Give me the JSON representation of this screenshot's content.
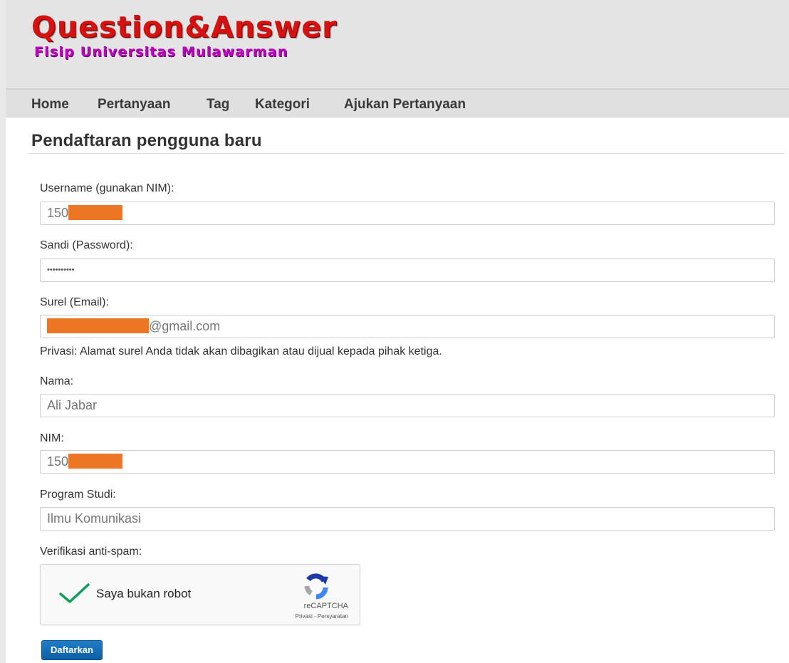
{
  "header": {
    "logo_main": "Question&Answer",
    "logo_sub": "Fisip Universitas Mulawarman"
  },
  "nav": {
    "items": [
      {
        "label": "Home"
      },
      {
        "label": "Pertanyaan"
      },
      {
        "label": "Tag"
      },
      {
        "label": "Kategori"
      },
      {
        "label": "Ajukan Pertanyaan"
      }
    ]
  },
  "page": {
    "title": "Pendaftaran pengguna baru"
  },
  "form": {
    "username": {
      "label": "Username (gunakan NIM):",
      "value": "150"
    },
    "password": {
      "label": "Sandi (Password):",
      "value": "••••••••••"
    },
    "email": {
      "label": "Surel (Email):",
      "value_suffix": "@gmail.com",
      "privacy_note": "Privasi: Alamat surel Anda tidak akan dibagikan atau dijual kepada pihak ketiga."
    },
    "nama": {
      "label": "Nama:",
      "value": "Ali Jabar"
    },
    "nim": {
      "label": "NIM:",
      "value": "150"
    },
    "program": {
      "label": "Program Studi:",
      "value": "Ilmu Komunikasi"
    },
    "verification_label": "Verifikasi anti-spam:",
    "captcha": {
      "text": "Saya bukan robot",
      "brand": "reCAPTCHA",
      "links": "Privasi - Persyaratan",
      "checked": true
    },
    "submit_label": "Daftarkan"
  },
  "colors": {
    "redaction": "#ec7624",
    "logo_main": "#d8100f",
    "logo_sub": "#c000c0",
    "button": "#1066b0",
    "check": "#0f9d58"
  },
  "icons": [
    "checkmark-icon",
    "recaptcha-logo-icon"
  ]
}
